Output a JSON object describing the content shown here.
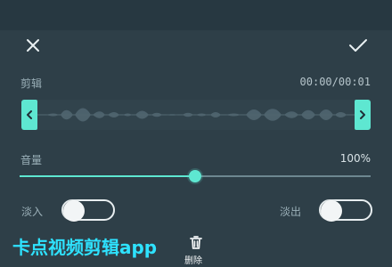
{
  "edit": {
    "clip_label": "剪辑",
    "duration": "00:00/00:01"
  },
  "volume": {
    "label": "音量",
    "value_text": "100%",
    "slider_fraction": 0.5
  },
  "fade": {
    "in_label": "淡入",
    "out_label": "淡出",
    "in_enabled": false,
    "out_enabled": false
  },
  "actions": {
    "delete_label": "删除"
  },
  "watermark": {
    "text": "卡点视频剪辑app"
  },
  "colors": {
    "accent": "#5ee7d1",
    "background": "#2e3f48",
    "text": "#d8e2e6",
    "watermark": "#2ee2ff"
  },
  "icons": {
    "close": "close-icon",
    "confirm": "check-icon",
    "left_handle": "chevron-left-icon",
    "right_handle": "chevron-right-icon",
    "delete": "trash-icon"
  }
}
